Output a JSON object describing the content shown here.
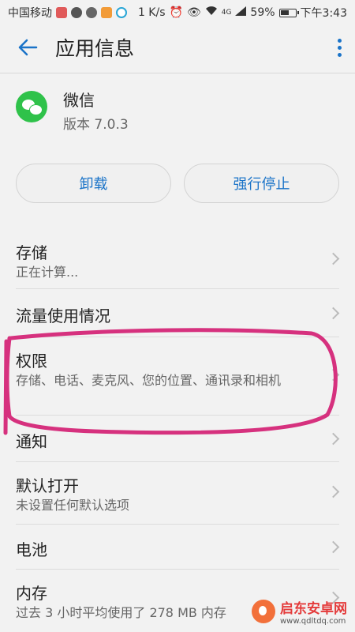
{
  "status_bar": {
    "carrier": "中国移动",
    "speed": "1 K/s",
    "network": "4G",
    "battery": "59%",
    "time": "下午3:43"
  },
  "app_bar": {
    "title": "应用信息"
  },
  "app": {
    "name": "微信",
    "version": "版本 7.0.3"
  },
  "actions": {
    "uninstall": "卸载",
    "force_stop": "强行停止"
  },
  "settings": [
    {
      "title": "存储",
      "subtitle": "正在计算..."
    },
    {
      "title": "流量使用情况",
      "subtitle": ""
    },
    {
      "title": "权限",
      "subtitle": "存储、电话、麦克风、您的位置、通讯录和相机"
    },
    {
      "title": "通知",
      "subtitle": ""
    },
    {
      "title": "默认打开",
      "subtitle": "未设置任何默认选项"
    },
    {
      "title": "电池",
      "subtitle": ""
    },
    {
      "title": "内存",
      "subtitle": "过去 3 小时平均使用了 278 MB 内存"
    }
  ],
  "watermark": {
    "name": "启东安卓网",
    "url": "www.qdltdq.com"
  },
  "colors": {
    "accent": "#1a73c8",
    "annotation": "#d6317e",
    "background": "#f2f2f2"
  }
}
